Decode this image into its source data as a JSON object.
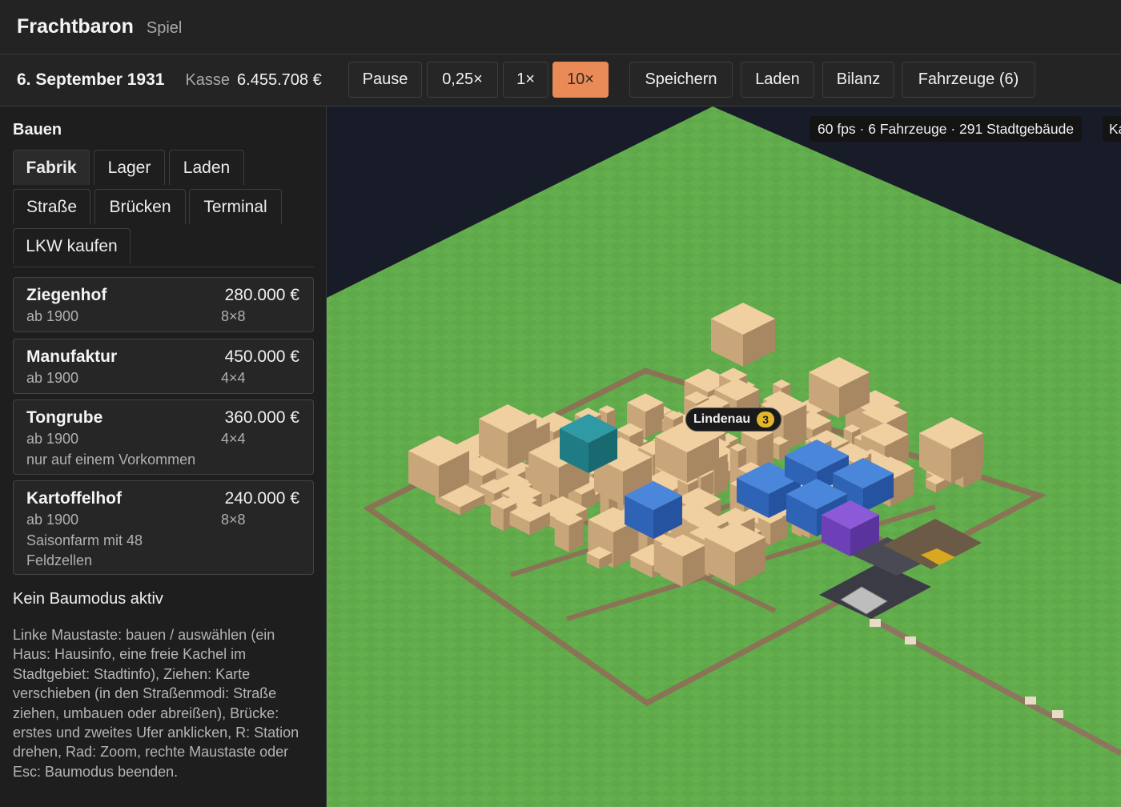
{
  "app": {
    "title": "Frachtbaron",
    "subtitle": "Spiel"
  },
  "toolbar": {
    "date": "6. September 1931",
    "cash_label": "Kasse",
    "cash_value": "6.455.708 €",
    "buttons": {
      "pause": "Pause",
      "speed_quarter": "0,25×",
      "speed_1": "1×",
      "speed_10": "10×",
      "save": "Speichern",
      "load": "Laden",
      "balance": "Bilanz",
      "vehicles": "Fahrzeuge (6)"
    },
    "active_speed": "10×"
  },
  "sidebar": {
    "heading": "Bauen",
    "tabs": {
      "factory": "Fabrik",
      "warehouse": "Lager",
      "shop": "Laden",
      "road": "Straße",
      "bridges": "Brücken",
      "terminal": "Terminal",
      "buy_truck": "LKW kaufen"
    },
    "active_tab": "Fabrik",
    "items": [
      {
        "name": "Ziegenhof",
        "price": "280.000 €",
        "since": "ab 1900",
        "size": "8×8",
        "note": ""
      },
      {
        "name": "Manufaktur",
        "price": "450.000 €",
        "since": "ab 1900",
        "size": "4×4",
        "note": ""
      },
      {
        "name": "Tongrube",
        "price": "360.000 €",
        "since": "ab 1900",
        "size": "4×4",
        "note": "nur auf einem Vorkommen"
      },
      {
        "name": "Kartoffelhof",
        "price": "240.000 €",
        "since": "ab 1900",
        "size": "8×8",
        "note": "Saisonfarm mit 48 Feldzellen"
      }
    ],
    "mode_status": "Kein Baumodus aktiv",
    "help_text": "Linke Maustaste: bauen / auswählen (ein Haus: Hausinfo, eine freie Kachel im Stadtgebiet: Stadtinfo), Ziehen: Karte verschieben (in den Straßenmodi: Straße ziehen, umbauen oder abreißen), Brücke: erstes und zweites Ufer anklicken, R: Station drehen, Rad: Zoom, rechte Maustaste oder Esc: Baumodus beenden."
  },
  "viewport": {
    "stats": "60 fps · 6 Fahrzeuge · 291 Stadtgebäude",
    "stats_cut": "Ka",
    "city_name": "Lindenau",
    "city_level": "3",
    "colors": {
      "grass": "#62ad4c",
      "sky": "#181c28",
      "road": "#8b7355",
      "building_top": "#ecc99a",
      "accent": "#e98a57"
    }
  }
}
